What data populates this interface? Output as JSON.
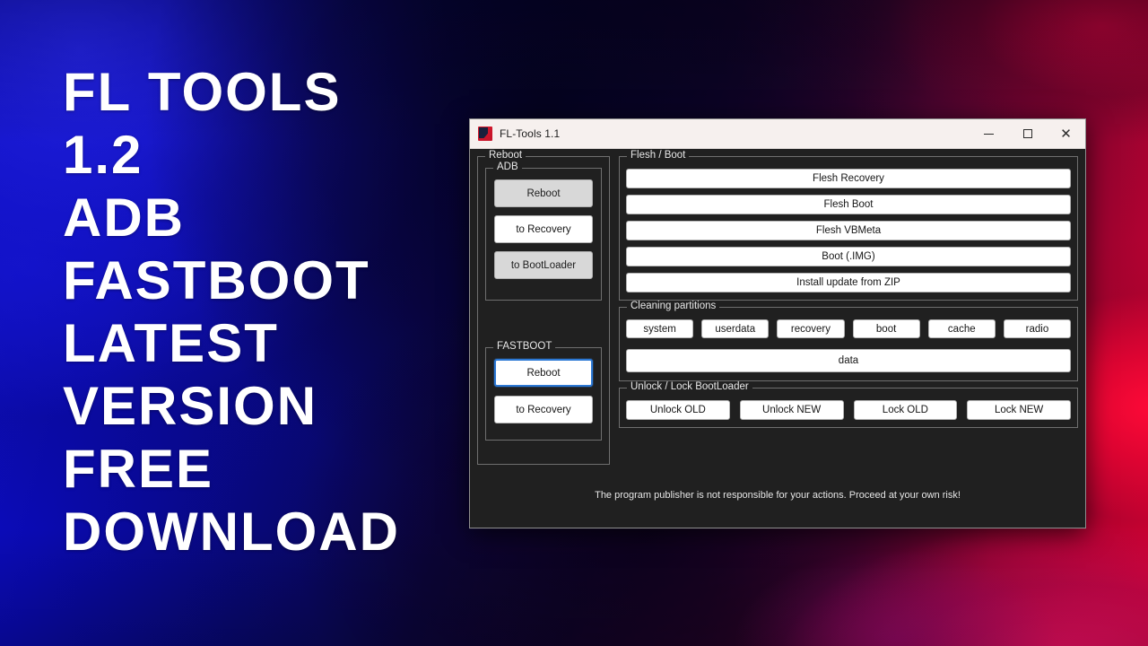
{
  "promo": {
    "lines": [
      "FL TOOLS",
      "1.2",
      "ADB",
      "FASTBOOT",
      "LATEST",
      "VERSION",
      "FREE",
      "DOWNLOAD"
    ]
  },
  "window": {
    "title": "FL-Tools 1.1",
    "icon": "app-icon",
    "controls": {
      "minimize": "minimize-icon",
      "maximize": "maximize-icon",
      "close": "close-icon"
    }
  },
  "reboot_group": {
    "title": "Reboot",
    "adb": {
      "title": "ADB",
      "buttons": [
        {
          "label": "Reboot",
          "style": "dim"
        },
        {
          "label": "to Recovery",
          "style": "normal"
        },
        {
          "label": "to BootLoader",
          "style": "dim"
        }
      ]
    },
    "fastboot": {
      "title": "FASTBOOT",
      "buttons": [
        {
          "label": "Reboot",
          "style": "focused"
        },
        {
          "label": "to Recovery",
          "style": "normal"
        }
      ]
    }
  },
  "flash_group": {
    "title": "Flesh / Boot",
    "buttons": [
      "Flesh Recovery",
      "Flesh Boot",
      "Flesh VBMeta",
      "Boot (.IMG)",
      "Install update from ZIP"
    ]
  },
  "clean_group": {
    "title": "Cleaning partitions",
    "partitions": [
      "system",
      "userdata",
      "recovery",
      "boot",
      "cache",
      "radio"
    ],
    "wide_button": "data"
  },
  "unlock_group": {
    "title": "Unlock / Lock BootLoader",
    "buttons": [
      "Unlock OLD",
      "Unlock NEW",
      "Lock OLD",
      "Lock NEW"
    ]
  },
  "disclaimer": "The program publisher is not responsible for your actions. Proceed at your own risk!",
  "colors": {
    "accent_blue": "#0f0fd8",
    "accent_red": "#e30134",
    "accent_pink": "#ff126e",
    "window_bg": "#202020",
    "titlebar_bg": "#f6f0ee",
    "button_bg": "#ffffff",
    "button_dim_bg": "#d8d8d8",
    "focus_border": "#2c78d4",
    "group_border": "#6f6f6f",
    "text_light": "#e8e8e8",
    "text_dark": "#161616"
  }
}
